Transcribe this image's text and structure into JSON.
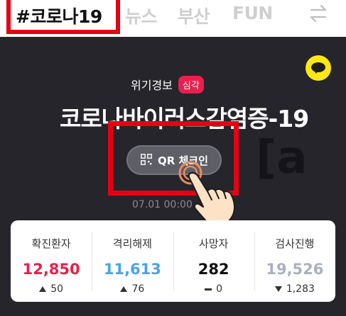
{
  "tabs": [
    {
      "label": "#코로나19",
      "active": true
    },
    {
      "label": "뉴스",
      "active": false
    },
    {
      "label": "부산",
      "active": false
    },
    {
      "label": "FUN",
      "active": false
    }
  ],
  "header": {
    "alert_label": "위기경보",
    "alert_level": "심각",
    "title": "코로나바이러스감염증-19",
    "background_text": "[a",
    "qr_button_label": "QR 체크인",
    "date_text": "07.01 00:00"
  },
  "stats": [
    {
      "label": "확진환자",
      "value": "12,850",
      "change": "50",
      "direction": "up",
      "color": "#e8204e"
    },
    {
      "label": "격리해제",
      "value": "11,613",
      "change": "76",
      "direction": "up",
      "color": "#4aa3e8"
    },
    {
      "label": "사망자",
      "value": "282",
      "change": "0",
      "direction": "none",
      "color": "#111111"
    },
    {
      "label": "검사진행",
      "value": "19,526",
      "change": "1,283",
      "direction": "down",
      "color": "#a9b1be"
    }
  ],
  "colors": {
    "highlight": "#e60012",
    "dark_bg": "#25252b",
    "badge": "#e8204e",
    "kakao": "#ffe812"
  },
  "icons": [
    "swap-icon",
    "kakao-chat-icon",
    "qr-icon",
    "tap-hand-icon",
    "arrow-up-icon",
    "arrow-down-icon",
    "dash-icon"
  ]
}
